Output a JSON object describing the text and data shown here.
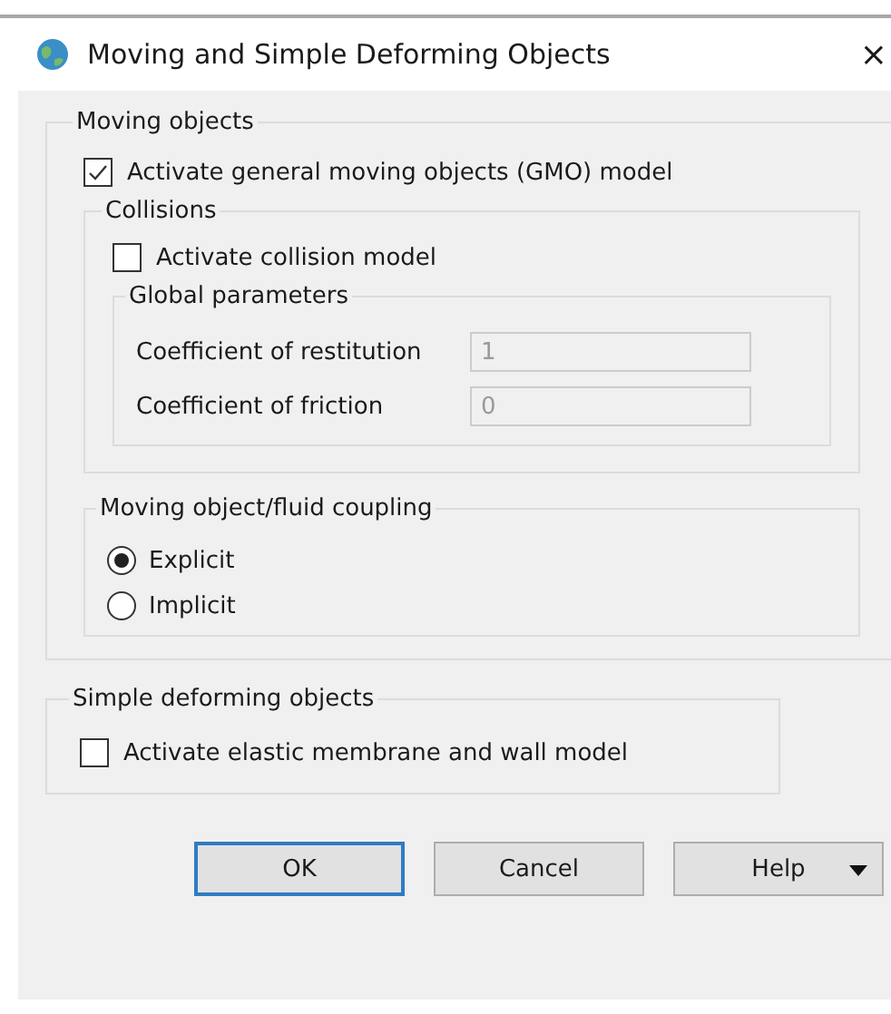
{
  "window": {
    "title": "Moving and Simple Deforming Objects",
    "close": "×"
  },
  "moving_objects": {
    "title": "Moving objects",
    "gmo": {
      "label": "Activate general moving objects (GMO) model",
      "checked": true
    },
    "collisions": {
      "title": "Collisions",
      "activate": {
        "label": "Activate collision model",
        "checked": false
      },
      "global_parameters": {
        "title": "Global parameters",
        "fields": [
          {
            "label": "Coefficient of restitution",
            "value": "1",
            "disabled": true
          },
          {
            "label": "Coefficient of friction",
            "value": "0",
            "disabled": true
          }
        ]
      }
    },
    "coupling": {
      "title": "Moving object/fluid coupling",
      "options": [
        {
          "label": "Explicit",
          "selected": true
        },
        {
          "label": "Implicit",
          "selected": false
        }
      ]
    }
  },
  "simple_deforming": {
    "title": "Simple deforming objects",
    "membrane": {
      "label": "Activate elastic membrane and wall model",
      "checked": false
    }
  },
  "buttons": [
    {
      "label": "OK",
      "default": true,
      "dropdown": false
    },
    {
      "label": "Cancel",
      "default": false,
      "dropdown": false
    },
    {
      "label": "Help",
      "default": false,
      "dropdown": true
    }
  ]
}
